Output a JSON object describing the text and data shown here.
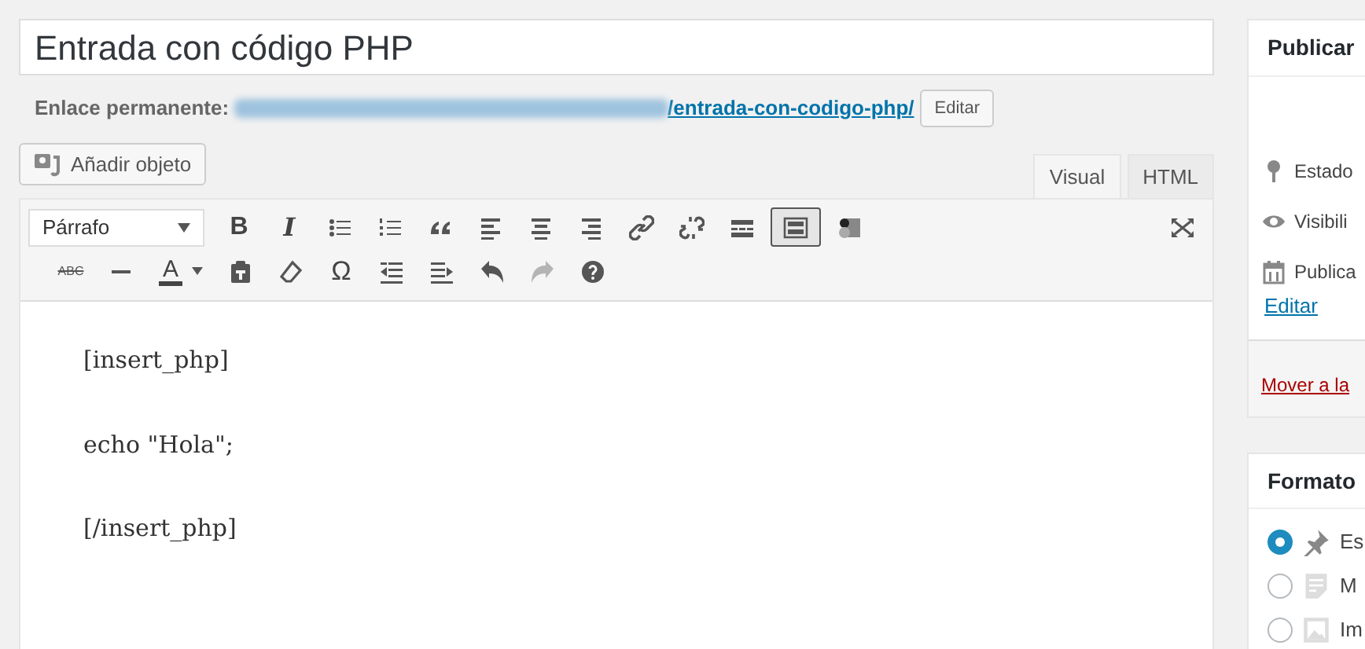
{
  "title_field": {
    "value": "Entrada con código PHP"
  },
  "permalink": {
    "label": "Enlace permanente:",
    "slug": "/entrada-con-codigo-php/",
    "button": "Editar"
  },
  "add_media_button": "Añadir objeto",
  "editor_tabs": [
    {
      "label": "Visual",
      "selected": true
    },
    {
      "label": "HTML",
      "selected": false
    }
  ],
  "format_select": {
    "value": "Párrafo"
  },
  "toolbar_row_1": [
    {
      "kind": "bold",
      "label": "B",
      "pressed": false,
      "disabled": false
    },
    {
      "kind": "italic",
      "label": "I",
      "pressed": false,
      "disabled": false
    },
    {
      "kind": "bullets",
      "pressed": false,
      "disabled": false
    },
    {
      "kind": "numbers",
      "pressed": false,
      "disabled": false
    },
    {
      "kind": "quote",
      "pressed": false,
      "disabled": false
    },
    {
      "kind": "align_left",
      "pressed": false,
      "disabled": false
    },
    {
      "kind": "align_center",
      "pressed": false,
      "disabled": false
    },
    {
      "kind": "align_right",
      "pressed": false,
      "disabled": false
    },
    {
      "kind": "link",
      "pressed": false,
      "disabled": false
    },
    {
      "kind": "unlink",
      "pressed": false,
      "disabled": false
    },
    {
      "kind": "more",
      "pressed": false,
      "disabled": false
    },
    {
      "kind": "toolbar_toggle",
      "pressed": true,
      "disabled": false
    },
    {
      "kind": "plugin",
      "pressed": false,
      "disabled": false
    }
  ],
  "toolbar_row_2": [
    {
      "kind": "strike",
      "label": "ABC",
      "pressed": false,
      "disabled": false
    },
    {
      "kind": "hr",
      "pressed": false,
      "disabled": false
    },
    {
      "kind": "text_color",
      "label": "A",
      "pressed": false,
      "disabled": false
    },
    {
      "kind": "paste",
      "pressed": false,
      "disabled": false
    },
    {
      "kind": "eraser",
      "pressed": false,
      "disabled": false
    },
    {
      "kind": "omega",
      "label": "Ω",
      "pressed": false,
      "disabled": false
    },
    {
      "kind": "outdent",
      "pressed": false,
      "disabled": false
    },
    {
      "kind": "indent",
      "pressed": false,
      "disabled": false
    },
    {
      "kind": "undo",
      "pressed": false,
      "disabled": false
    },
    {
      "kind": "redo",
      "pressed": false,
      "disabled": true
    },
    {
      "kind": "help",
      "pressed": false,
      "disabled": false
    }
  ],
  "content": [
    "[insert_php]",
    "echo \"Hola\";",
    "[/insert_php]"
  ],
  "publish_box": {
    "title": "Publicar",
    "items": [
      {
        "kind": "pin",
        "label": "Estado"
      },
      {
        "kind": "eye",
        "label": "Visibili"
      },
      {
        "kind": "calendar",
        "label": "Publica"
      }
    ],
    "edit_link": "Editar",
    "trash_link": "Mover a la"
  },
  "format_box": {
    "title": "Formato",
    "options": [
      {
        "kind": "pin",
        "label": "Es",
        "selected": true
      },
      {
        "kind": "note",
        "label": "M",
        "selected": false
      },
      {
        "kind": "image",
        "label": "Im",
        "selected": false
      }
    ]
  }
}
